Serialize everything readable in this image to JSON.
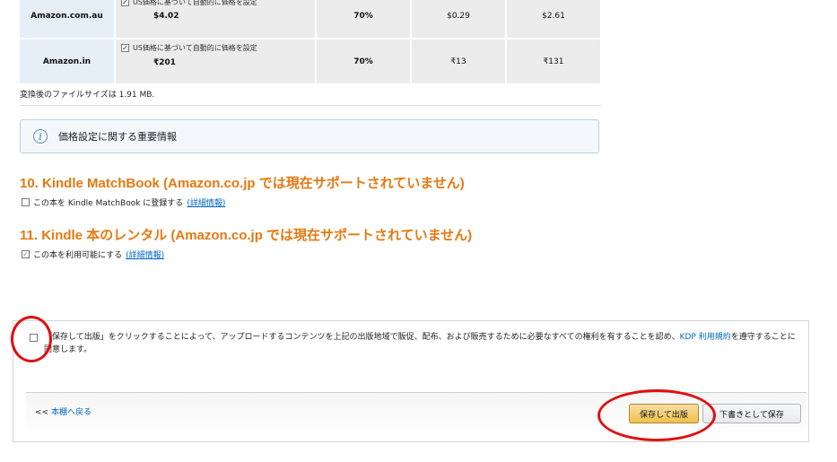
{
  "pricing_rows": [
    {
      "market": "Amazon.com.au",
      "auto_label": "US価格に基づいて自動的に価格を設定",
      "price": "$4.02",
      "royalty": "70%",
      "fee": "$0.29",
      "net": "$2.61"
    },
    {
      "market": "Amazon.in",
      "auto_label": "US価格に基づいて自動的に価格を設定",
      "price": "₹201",
      "royalty": "70%",
      "fee": "₹13",
      "net": "₹131"
    }
  ],
  "file_size_text": "変換後のファイルサイズは 1.91 MB.",
  "info_box": {
    "text": "価格設定に関する重要情報"
  },
  "section10": {
    "title": "10. Kindle MatchBook (Amazon.co.jp では現在サポートされていません)",
    "checkbox_label": "この本を Kindle MatchBook に登録する",
    "link": "(詳細情報)",
    "checked": false
  },
  "section11": {
    "title": "11. Kindle 本のレンタル (Amazon.co.jp では現在サポートされていません)",
    "checkbox_label": "この本を利用可能にする",
    "link": "(詳細情報)",
    "checked": true
  },
  "agreement": {
    "text_before": "「保存して出版」をクリックすることによって、アップロードするコンテンツを上記の出版地域で販促、配布、および販売するために必要なすべての権利を有することを認め、",
    "link": "KDP 利用規約",
    "text_after": "を遵守することに同意します。",
    "checked": false
  },
  "footer": {
    "back_arrows": "<<",
    "back_label": "本棚へ戻る",
    "publish_label": "保存して出版",
    "draft_label": "下書きとして保存"
  },
  "colors": {
    "section_title": "#e47911",
    "link": "#0066c0",
    "annotation": "#e01010",
    "publish_button": "#f0c14b"
  }
}
